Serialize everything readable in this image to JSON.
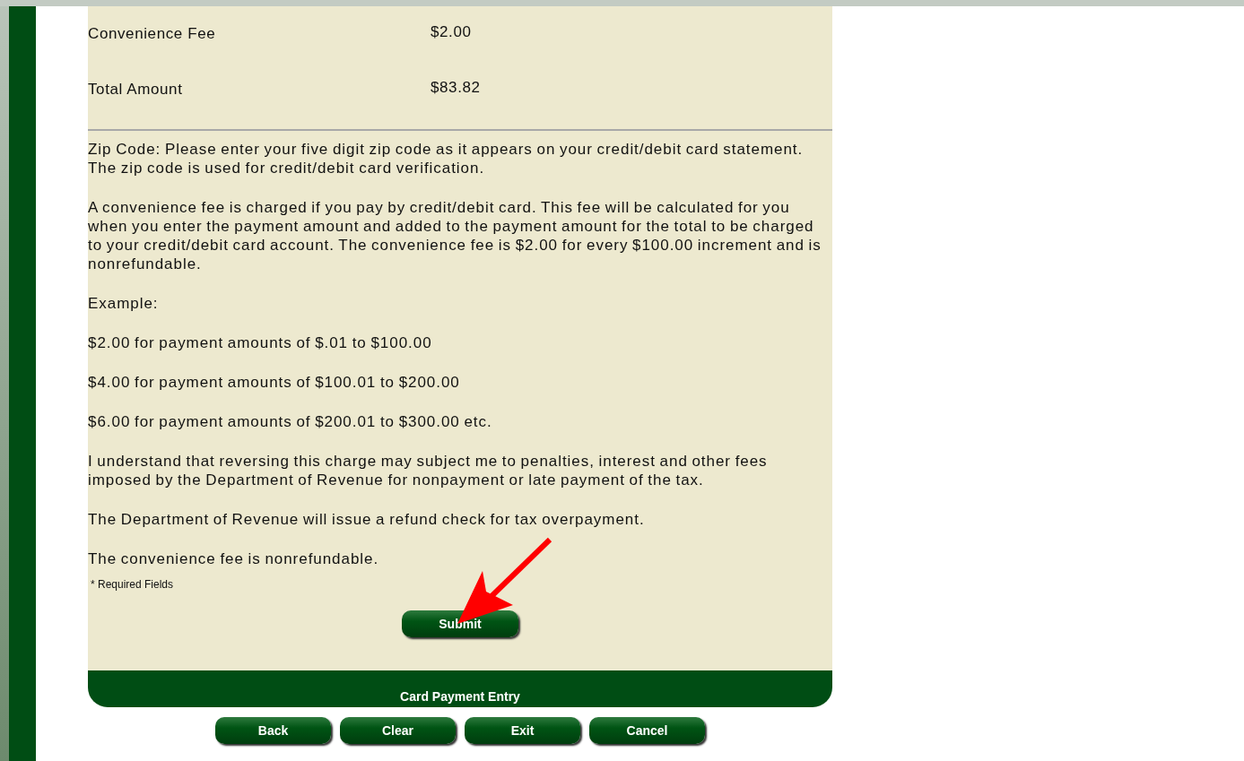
{
  "summary_rows": [
    {
      "label": "Convenience Fee",
      "value": "$2.00"
    },
    {
      "label": "Total Amount",
      "value": "$83.82"
    }
  ],
  "paragraphs": [
    "Zip Code: Please enter your five digit zip code as it appears on your credit/debit card statement. The zip code is used for credit/debit card verification.",
    "A convenience fee is charged if you pay by credit/debit card. This fee will be calculated for you when you enter the payment amount and added to the payment amount for the total to be charged to your credit/debit card account. The convenience fee is $2.00 for every $100.00 increment and is nonrefundable.",
    "Example:",
    "$2.00 for payment amounts of $.01 to $100.00",
    "$4.00 for payment amounts of $100.01 to $200.00",
    "$6.00 for payment amounts of $200.01 to $300.00 etc.",
    "I understand that reversing this charge may subject me to penalties, interest and other fees imposed by the Department of Revenue for nonpayment or late payment of the tax.",
    "The Department of Revenue will issue a refund check for tax overpayment.",
    "The convenience fee is nonrefundable."
  ],
  "required_note": "* Required Fields",
  "submit_button": "Submit",
  "footer_title": "Card Payment Entry",
  "nav_buttons": [
    "Back",
    "Clear",
    "Exit",
    "Cancel"
  ]
}
